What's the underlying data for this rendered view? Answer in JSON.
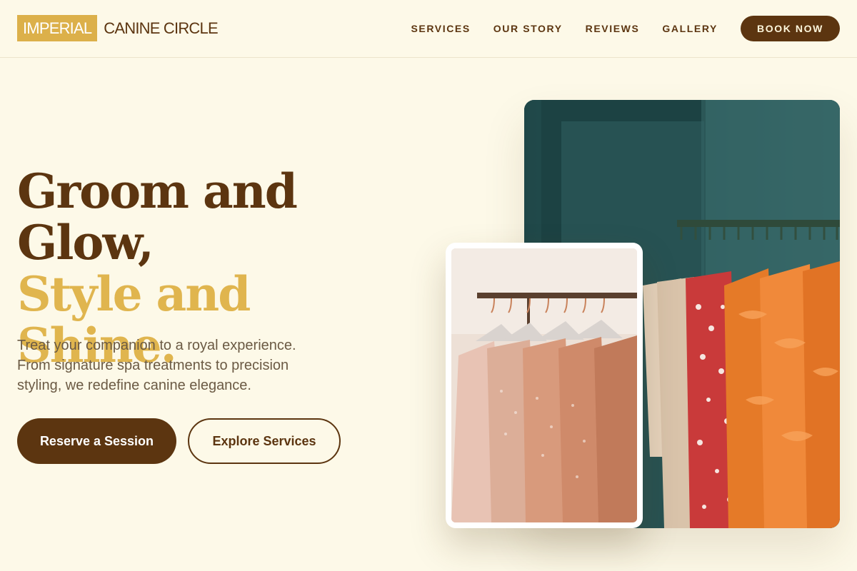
{
  "brand": {
    "badge": "IMPERIAL",
    "name": "CANINE CIRCLE"
  },
  "nav": {
    "items": [
      "SERVICES",
      "OUR STORY",
      "REVIEWS",
      "GALLERY"
    ],
    "cta": "BOOK NOW"
  },
  "hero": {
    "title_line1": "Groom and",
    "title_line2": "Glow,",
    "title_accent": "Style and Shine.",
    "subtitle": "Treat your companion to a royal experience. From signature spa treatments to precision styling, we redefine canine elegance.",
    "primary_cta": "Reserve a Session",
    "secondary_cta": "Explore Services"
  },
  "colors": {
    "background": "#fdf9e8",
    "brown": "#5c3510",
    "gold": "#e0b54e"
  }
}
